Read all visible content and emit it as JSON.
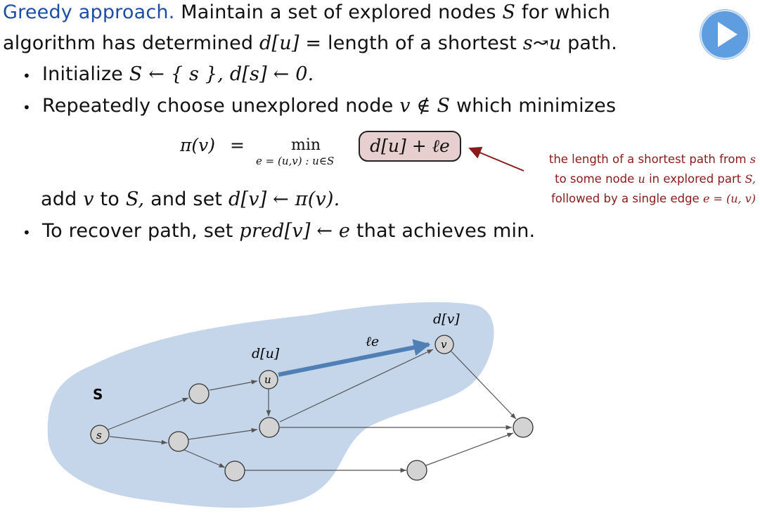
{
  "intro": {
    "heading": "Greedy approach.",
    "text1": "Maintain a set of explored nodes",
    "var_S": "S",
    "text2": "for which",
    "text3": "algorithm has determined",
    "d_u": "d[u]",
    "text4": "= length of a shortest",
    "path_expr": "s↝u",
    "text5": "path."
  },
  "bullets": {
    "init": {
      "label": "Initialize",
      "expr": "S ← { s },  d[s] ← 0."
    },
    "repeat": {
      "label": "Repeatedly choose unexplored node",
      "expr": "v ∉ S",
      "tail": "which minimizes"
    },
    "add": {
      "label_add": "add",
      "v": "v",
      "label_to": "to",
      "S": "S,",
      "label_set": "and set",
      "expr": "d[v] ← π(v)."
    },
    "recover": {
      "label": "To recover path, set",
      "expr": "pred[v] ← e",
      "tail": "that achieves min."
    }
  },
  "formula": {
    "lhs": "π(v)",
    "eq": "=",
    "min": "min",
    "sub": "e = (u,v) : u∈S",
    "boxed": "d[u] + ℓe"
  },
  "annotation": {
    "line1": "the length of a shortest path from",
    "line1_var": "s",
    "line2": "to some node",
    "line2_var": "u",
    "line2b": "in explored part",
    "line2_var2": "S,",
    "line3": "followed by a single edge",
    "line3_expr": "e = (u, v)"
  },
  "diagram": {
    "region_label": "S",
    "node_s": "s",
    "node_u": "u",
    "node_v": "v",
    "label_du": "d[u]",
    "label_dv": "d[v]",
    "label_le": "ℓe"
  },
  "colors": {
    "accent": "#1a4fa5",
    "annotation": "#8b1a1a",
    "region": "#c5d6ea",
    "highlight_box": "#e8cfcf",
    "edge_highlight": "#4f7fb5",
    "play_button": "#5e9ee0"
  }
}
